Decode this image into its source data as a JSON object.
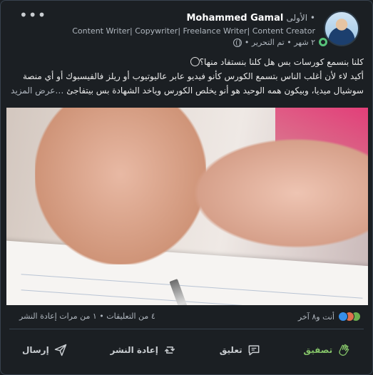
{
  "post": {
    "author_name": "Mohammed Gamal",
    "degree": "• الأولى",
    "headline": "Content Writer| Copywriter| Freelance Writer| Content Creator",
    "meta": "٢ شهر • تم التحرير •",
    "text_line1": "كلنا بنسمع كورسات بس هل كلنا بنستفاد منها؟",
    "text_line2": "أكيد لاء لأن أغلب الناس بتسمع الكورس كأنو فيديو عابر عاليوتيوب أو ريلز فالفيسبوك أو أي منصة",
    "text_line3": "سوشيال ميديا، وبيكون همه الوحيد هو أنو يخلص الكورس وياخد الشهادة بس بيتفاجئ",
    "see_more": "…عرض المزيد"
  },
  "counts": {
    "reactions_text": "أنت و٨ آخر",
    "stats_text": "٤ من التعليقات • ١ من مرات إعادة النشر"
  },
  "actions": {
    "like": "تصفيق",
    "comment": "تعليق",
    "repost": "إعادة النشر",
    "send": "إرسال"
  },
  "colors": {
    "accent_green": "#84c268",
    "background": "#1b1f23",
    "like_blue": "#378fe9"
  },
  "icons": [
    "more-icon",
    "globe-icon",
    "clap-icon",
    "comment-icon",
    "repost-icon",
    "send-icon"
  ]
}
